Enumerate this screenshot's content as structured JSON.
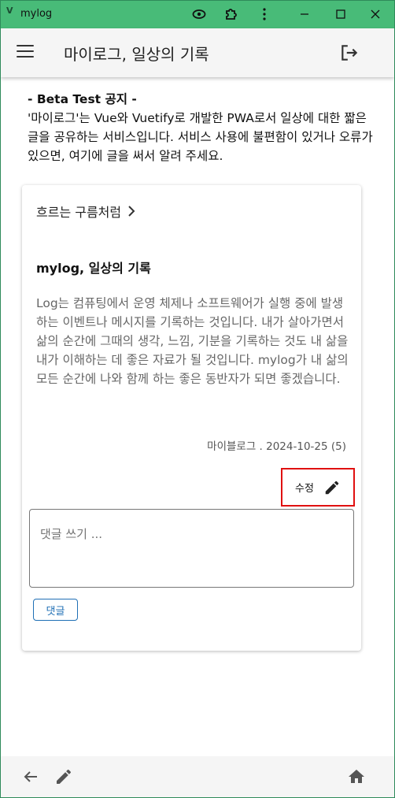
{
  "window": {
    "title": "mylog",
    "logo": "V"
  },
  "titlebar_icons": [
    "eye-icon",
    "extension-icon",
    "more-vert-icon",
    "minimize-icon",
    "maximize-icon",
    "close-icon"
  ],
  "appbar": {
    "title": "마이로그, 일상의 기록",
    "menu_icon": "menu-icon",
    "logout_icon": "logout-icon"
  },
  "notice": {
    "title": "- Beta Test 공지 -",
    "body": "'마이로그'는 Vue와 Vuetify로 개발한 PWA로서 일상에 대한 짧은 글을 공유하는 서비스입니다. 서비스 사용에 불편함이 있거나 오류가 있으면, 여기에 글을 써서 알려 주세요."
  },
  "card": {
    "category": "흐르는 구름처럼",
    "title": "mylog, 일상의 기록",
    "body": "Log는 컴퓨팅에서 운영 체제나 소프트웨어가 실행 중에 발생하는 이벤트나 메시지를 기록하는 것입니다. 내가 살아가면서 삶의 순간에 그때의 생각, 느낌, 기분을 기록하는 것도 내 삶을 내가 이해하는 데 좋은 자료가 될 것입니다. mylog가 내 삶의 모든 순간에 나와 함께 하는 좋은 동반자가 되면 좋겠습니다.",
    "meta": "마이블로그 . 2024-10-25 (5)",
    "edit_label": "수정",
    "comment_placeholder": "댓글 쓰기 ...",
    "comment_button": "댓글"
  },
  "bottombar": {
    "icons": [
      "arrow-back-icon",
      "pencil-icon",
      "home-icon"
    ]
  },
  "colors": {
    "titlebar": "#48bb78",
    "highlight_border": "#e01010",
    "button_blue": "#1f6fb5"
  }
}
